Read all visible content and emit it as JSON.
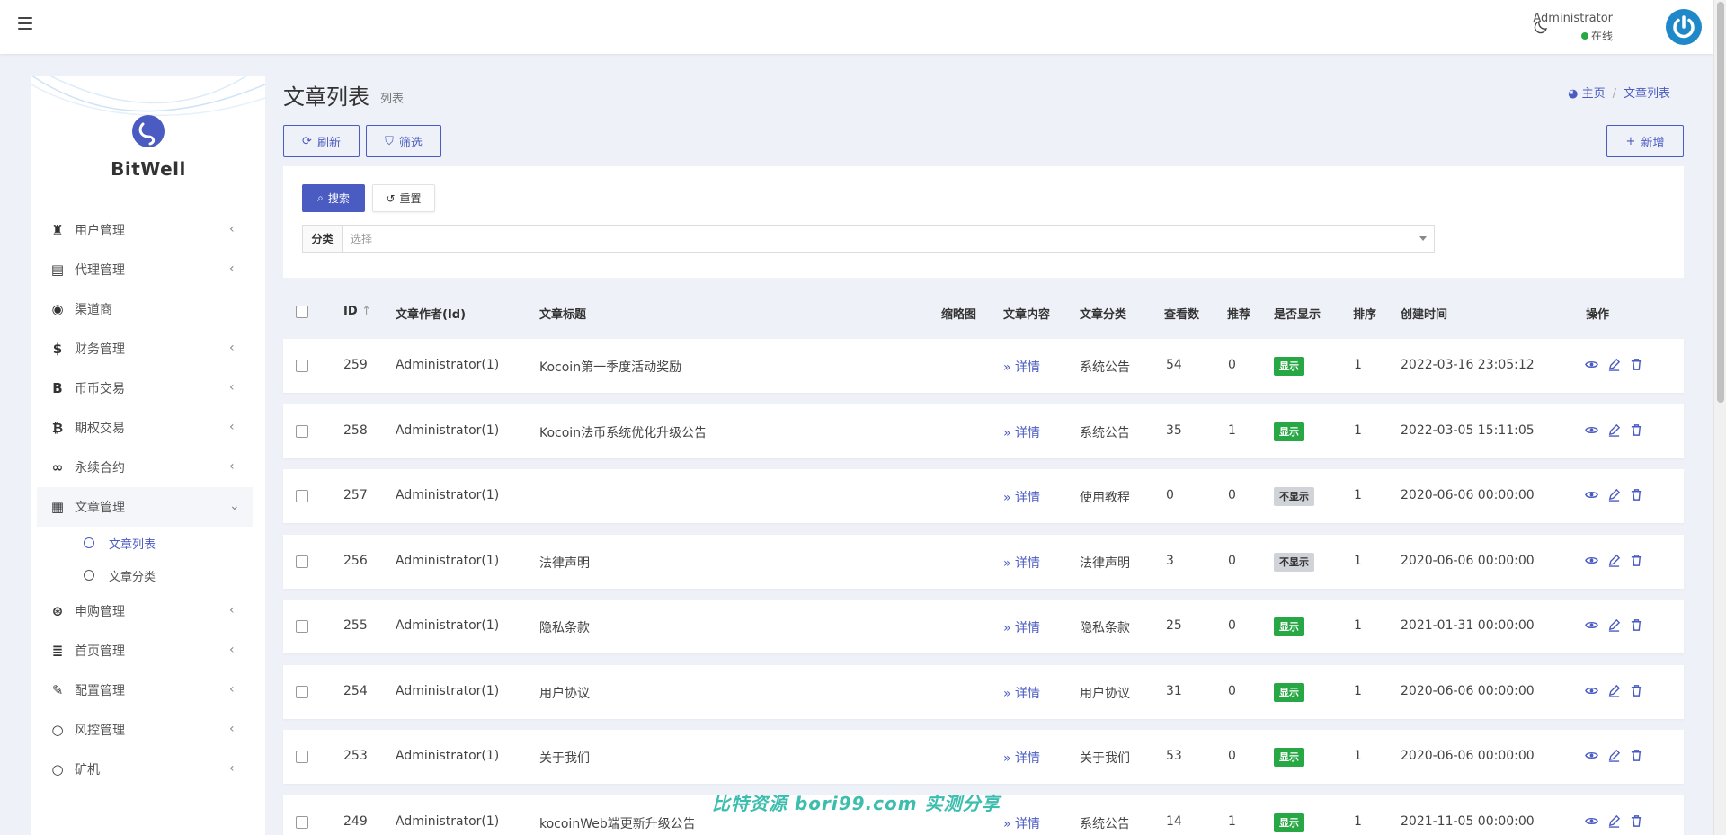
{
  "header": {
    "user_name": "Administrator",
    "user_status": "在线"
  },
  "brand": {
    "name": "BitWell"
  },
  "sidebar": {
    "items": [
      {
        "label": "用户管理",
        "icon": "users-icon"
      },
      {
        "label": "代理管理",
        "icon": "id-card-icon"
      },
      {
        "label": "渠道商",
        "icon": "user-circle-icon"
      },
      {
        "label": "财务管理",
        "icon": "dollar-icon"
      },
      {
        "label": "币币交易",
        "icon": "bitcoin-b-icon"
      },
      {
        "label": "期权交易",
        "icon": "bitcoin-icon"
      },
      {
        "label": "永续合约",
        "icon": "link-icon"
      },
      {
        "label": "文章管理",
        "icon": "newspaper-icon"
      },
      {
        "label": "申购管理",
        "icon": "lifebuoy-icon"
      },
      {
        "label": "首页管理",
        "icon": "list-icon"
      },
      {
        "label": "配置管理",
        "icon": "wrench-icon"
      },
      {
        "label": "风控管理",
        "icon": "circle-icon"
      },
      {
        "label": "矿机",
        "icon": "circle-icon"
      }
    ],
    "submenu": [
      {
        "label": "文章列表"
      },
      {
        "label": "文章分类"
      }
    ]
  },
  "page": {
    "title": "文章列表",
    "subtitle": "列表",
    "breadcrumb": {
      "home": "主页",
      "current": "文章列表"
    }
  },
  "toolbar": {
    "refresh": "刷新",
    "filter": "筛选",
    "add": "新增"
  },
  "search": {
    "search_label": "搜索",
    "reset_label": "重置",
    "category_label": "分类",
    "category_placeholder": "选择"
  },
  "table": {
    "columns": {
      "id": "ID",
      "author": "文章作者(Id)",
      "title": "文章标题",
      "thumb": "缩略图",
      "content": "文章内容",
      "category": "文章分类",
      "views": "查看数",
      "recommend": "推荐",
      "visible": "是否显示",
      "sort": "排序",
      "created": "创建时间",
      "actions": "操作"
    },
    "detail_label": "详情",
    "rows": [
      {
        "id": "259",
        "author": "Administrator(1)",
        "title": "Kocoin第一季度活动奖励",
        "category": "系统公告",
        "views": "54",
        "recommend": "0",
        "visible": "显示",
        "visible_on": true,
        "sort": "1",
        "created": "2022-03-16 23:05:12"
      },
      {
        "id": "258",
        "author": "Administrator(1)",
        "title": "Kocoin法币系统优化升级公告",
        "category": "系统公告",
        "views": "35",
        "recommend": "1",
        "visible": "显示",
        "visible_on": true,
        "sort": "1",
        "created": "2022-03-05 15:11:05"
      },
      {
        "id": "257",
        "author": "Administrator(1)",
        "title": "",
        "category": "使用教程",
        "views": "0",
        "recommend": "0",
        "visible": "不显示",
        "visible_on": false,
        "sort": "1",
        "created": "2020-06-06 00:00:00"
      },
      {
        "id": "256",
        "author": "Administrator(1)",
        "title": "法律声明",
        "category": "法律声明",
        "views": "3",
        "recommend": "0",
        "visible": "不显示",
        "visible_on": false,
        "sort": "1",
        "created": "2020-06-06 00:00:00"
      },
      {
        "id": "255",
        "author": "Administrator(1)",
        "title": "隐私条款",
        "category": "隐私条款",
        "views": "25",
        "recommend": "0",
        "visible": "显示",
        "visible_on": true,
        "sort": "1",
        "created": "2021-01-31 00:00:00"
      },
      {
        "id": "254",
        "author": "Administrator(1)",
        "title": "用户协议",
        "category": "用户协议",
        "views": "31",
        "recommend": "0",
        "visible": "显示",
        "visible_on": true,
        "sort": "1",
        "created": "2020-06-06 00:00:00"
      },
      {
        "id": "253",
        "author": "Administrator(1)",
        "title": "关于我们",
        "category": "关于我们",
        "views": "53",
        "recommend": "0",
        "visible": "显示",
        "visible_on": true,
        "sort": "1",
        "created": "2020-06-06 00:00:00"
      },
      {
        "id": "249",
        "author": "Administrator(1)",
        "title": "kocoinWeb端更新升级公告",
        "category": "系统公告",
        "views": "14",
        "recommend": "1",
        "visible": "显示",
        "visible_on": true,
        "sort": "1",
        "created": "2021-11-05 00:00:00"
      }
    ]
  },
  "watermark": "比特资源 bori99.com 实测分享",
  "colors": {
    "accent": "#4a5bc2",
    "success": "#28a745",
    "muted_badge": "#d0d3d8"
  }
}
